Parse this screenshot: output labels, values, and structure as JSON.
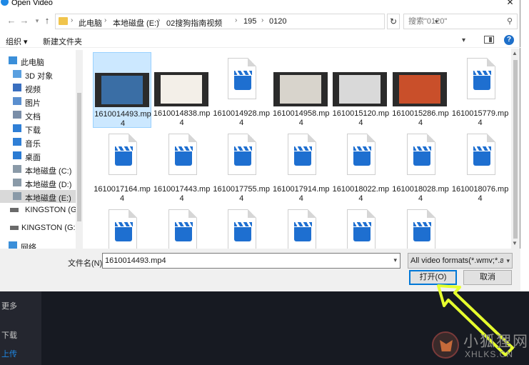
{
  "window": {
    "title": "Open Video",
    "close_glyph": "✕"
  },
  "nav": {
    "breadcrumbs": [
      "此电脑",
      "本地磁盘 (E:)",
      "02搜狗指南视频",
      "195",
      "0120"
    ],
    "search_placeholder": "搜索\"0120\""
  },
  "toolbar": {
    "organize_label": "组织 ▾",
    "new_folder_label": "新建文件夹"
  },
  "sidebar": {
    "items": [
      {
        "label": "此电脑",
        "icon": "computer-icon"
      },
      {
        "label": "3D 对象",
        "icon": "cube-icon"
      },
      {
        "label": "视频",
        "icon": "video-folder-icon"
      },
      {
        "label": "图片",
        "icon": "pictures-folder-icon"
      },
      {
        "label": "文档",
        "icon": "documents-folder-icon"
      },
      {
        "label": "下载",
        "icon": "download-icon"
      },
      {
        "label": "音乐",
        "icon": "music-icon"
      },
      {
        "label": "桌面",
        "icon": "desktop-icon"
      },
      {
        "label": "本地磁盘 (C:)",
        "icon": "drive-icon"
      },
      {
        "label": "本地磁盘 (D:)",
        "icon": "drive-icon"
      },
      {
        "label": "本地磁盘 (E:)",
        "icon": "drive-icon",
        "selected": true
      },
      {
        "label": "KINGSTON (G:",
        "icon": "usb-drive-icon"
      },
      {
        "label": "KINGSTON (G:)",
        "icon": "usb-drive-icon"
      },
      {
        "label": "网络",
        "icon": "network-icon"
      }
    ]
  },
  "files": [
    {
      "line1": "1610014493.mp",
      "line2": "4",
      "kind": "thumb",
      "selected": true
    },
    {
      "line1": "1610014838.mp",
      "line2": "4",
      "kind": "thumb"
    },
    {
      "line1": "1610014928.mp",
      "line2": "4",
      "kind": "doc"
    },
    {
      "line1": "1610014958.mp",
      "line2": "4",
      "kind": "thumb"
    },
    {
      "line1": "1610015120.mp",
      "line2": "4",
      "kind": "thumb"
    },
    {
      "line1": "1610015286.mp",
      "line2": "4",
      "kind": "thumb"
    },
    {
      "line1": "1610015779.mp",
      "line2": "4",
      "kind": "doc"
    },
    {
      "line1": "1610017164.mp",
      "line2": "4",
      "kind": "doc"
    },
    {
      "line1": "1610017443.mp",
      "line2": "4",
      "kind": "doc"
    },
    {
      "line1": "1610017755.mp",
      "line2": "4",
      "kind": "doc"
    },
    {
      "line1": "1610017914.mp",
      "line2": "4",
      "kind": "doc"
    },
    {
      "line1": "1610018022.mp",
      "line2": "4",
      "kind": "doc"
    },
    {
      "line1": "1610018028.mp",
      "line2": "4",
      "kind": "doc"
    },
    {
      "line1": "1610018076.mp",
      "line2": "4",
      "kind": "doc"
    },
    {
      "line1": "",
      "line2": "",
      "kind": "doc"
    },
    {
      "line1": "",
      "line2": "",
      "kind": "doc"
    },
    {
      "line1": "",
      "line2": "",
      "kind": "doc"
    },
    {
      "line1": "",
      "line2": "",
      "kind": "doc"
    },
    {
      "line1": "",
      "line2": "",
      "kind": "doc"
    },
    {
      "line1": "",
      "line2": "",
      "kind": "doc"
    }
  ],
  "bottom": {
    "filename_label": "文件名(N):",
    "filename_value": "1610014493.mp4",
    "filter_label": "All video formats(*.wmv;*.avi",
    "open_label": "打开(O)",
    "cancel_label": "取消"
  },
  "background_app": {
    "items": [
      "更多",
      "下载",
      "上传"
    ],
    "accent_color": "#1e88e5"
  },
  "watermark": {
    "cn": "小狐狸网",
    "en": "XHLKS.CN"
  },
  "colors": {
    "annotation_arrow": "#e6ff2e",
    "selection": "#cce8ff",
    "video_icon_blue": "#1e6fd0"
  }
}
